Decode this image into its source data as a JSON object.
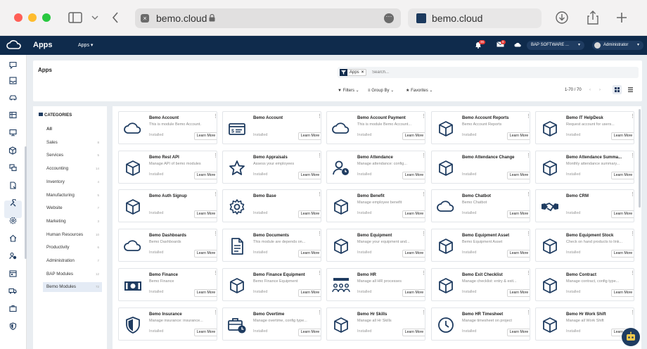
{
  "browser": {
    "url": "bemo.cloud",
    "tab_title": "bemo.cloud",
    "traffic_colors": [
      "#ff5f57",
      "#febc2e",
      "#28c840"
    ]
  },
  "navbar": {
    "title": "Apps",
    "apps_menu": "Apps ▾",
    "notifications_count": "36",
    "messages_count": "9",
    "company": "BAP SOFTWARE ...",
    "user": "Administrator",
    "bg_color": "#0f2b4c"
  },
  "sidebar": {
    "icons": [
      "chat-icon",
      "inbox-icon",
      "car-icon",
      "spreadsheet-icon",
      "desktop-icon",
      "box-icon",
      "chat-bubbles-icon",
      "document-icon",
      "tools-icon",
      "gear-icon",
      "home-icon",
      "user-clock-icon",
      "calendar-icon",
      "truck-icon",
      "briefcase-icon",
      "shield-icon"
    ]
  },
  "controls": {
    "breadcrumb": "Apps",
    "facet_label": "Apps",
    "search_placeholder": "Search...",
    "filters": "Filters",
    "group_by": "Group By",
    "favorites": "Favorites",
    "pager": "1-70 / 70"
  },
  "categories": {
    "heading": "CATEGORIES",
    "items": [
      {
        "label": "All",
        "count": ""
      },
      {
        "label": "Sales",
        "count": "8"
      },
      {
        "label": "Services",
        "count": "5"
      },
      {
        "label": "Accounting",
        "count": "14"
      },
      {
        "label": "Inventory",
        "count": "4"
      },
      {
        "label": "Manufacturing",
        "count": "5"
      },
      {
        "label": "Website",
        "count": "7"
      },
      {
        "label": "Marketing",
        "count": "3"
      },
      {
        "label": "Human Resources",
        "count": "10"
      },
      {
        "label": "Productivity",
        "count": "6"
      },
      {
        "label": "Administration",
        "count": "7"
      },
      {
        "label": "BAP Modules",
        "count": "12"
      },
      {
        "label": "Bemo Modules",
        "count": "72"
      }
    ]
  },
  "apps": [
    {
      "name": "Bemo Account",
      "desc": "This is module Bemo Account.",
      "status": "Installed",
      "button": "Learn More",
      "icon": "cloud-icon"
    },
    {
      "name": "Bemo Account",
      "desc": "",
      "status": "Installed",
      "button": "Learn More",
      "icon": "id-card-icon"
    },
    {
      "name": "Bemo Account Payment",
      "desc": "This is module Bemo Account...",
      "status": "Installed",
      "button": "Learn More",
      "icon": "cloud-icon"
    },
    {
      "name": "Bemo Account Reports",
      "desc": "Bemo Account Reports",
      "status": "Installed",
      "button": "Learn More",
      "icon": "box-icon"
    },
    {
      "name": "Bemo IT HelpDesk",
      "desc": "Request account for users...",
      "status": "Installed",
      "button": "Learn More",
      "icon": "box-icon"
    },
    {
      "name": "Bemo Rest API",
      "desc": "Manage API of bemo modules",
      "status": "Installed",
      "button": "Learn More",
      "icon": "box-icon"
    },
    {
      "name": "Bemo Appraisals",
      "desc": "Assess your employees",
      "status": "Installed",
      "button": "Learn More",
      "icon": "star-icon"
    },
    {
      "name": "Bemo Attendance",
      "desc": "Manage attendance: config...",
      "status": "Installed",
      "button": "Learn More",
      "icon": "user-clock-icon"
    },
    {
      "name": "Bemo Attendance Change",
      "desc": "",
      "status": "Installed",
      "button": "Learn More",
      "icon": "box-icon"
    },
    {
      "name": "Bemo Attendance Summa...",
      "desc": "Monthly attendance summary...",
      "status": "Installed",
      "button": "Learn More",
      "icon": "box-icon"
    },
    {
      "name": "Bemo Auth Signup",
      "desc": "",
      "status": "Installed",
      "button": "Learn More",
      "icon": "box-icon"
    },
    {
      "name": "Bemo Base",
      "desc": "",
      "status": "Installed",
      "button": "Learn More",
      "icon": "gear-icon"
    },
    {
      "name": "Bemo Benefit",
      "desc": "Manage employee benefit",
      "status": "Installed",
      "button": "Learn More",
      "icon": "box-icon"
    },
    {
      "name": "Bemo Chatbot",
      "desc": "Bemo Chatbot",
      "status": "Installed",
      "button": "Learn More",
      "icon": "cloud-icon"
    },
    {
      "name": "Bemo CRM",
      "desc": "",
      "status": "Installed",
      "button": "Learn More",
      "icon": "handshake-icon"
    },
    {
      "name": "Bemo Dashboards",
      "desc": "Bemo Dashboards",
      "status": "Installed",
      "button": "Learn More",
      "icon": "cloud-icon"
    },
    {
      "name": "Bemo Documents",
      "desc": "This module are depends on...",
      "status": "Installed",
      "button": "Learn More",
      "icon": "document-icon"
    },
    {
      "name": "Bemo Equipment",
      "desc": "Manage your equipment and...",
      "status": "Installed",
      "button": "Learn More",
      "icon": "box-icon"
    },
    {
      "name": "Bemo Equipment Asset",
      "desc": "Bemo Equipment Asset",
      "status": "Installed",
      "button": "Learn More",
      "icon": "box-icon"
    },
    {
      "name": "Bemo Equipment Stock",
      "desc": "Check on hand products to link...",
      "status": "Installed",
      "button": "Learn More",
      "icon": "box-icon"
    },
    {
      "name": "Bemo Finance",
      "desc": "Bemo Finance",
      "status": "Installed",
      "button": "Learn More",
      "icon": "money-icon"
    },
    {
      "name": "Bemo Finance Equipment",
      "desc": "Bemo Finance Equipment",
      "status": "Installed",
      "button": "Learn More",
      "icon": "box-icon"
    },
    {
      "name": "Bemo HR",
      "desc": "Manage all HR processes",
      "status": "Installed",
      "button": "Learn More",
      "icon": "people-icon"
    },
    {
      "name": "Bemo Exit Checklist",
      "desc": "Manage checklist: entry & exit...",
      "status": "Installed",
      "button": "Learn More",
      "icon": "box-icon"
    },
    {
      "name": "Bemo Contract",
      "desc": "Manage contract, config type...",
      "status": "Installed",
      "button": "Learn More",
      "icon": "box-icon"
    },
    {
      "name": "Bemo Insurance",
      "desc": "Manage insurance: insurance...",
      "status": "Installed",
      "button": "Learn More",
      "icon": "shield-icon"
    },
    {
      "name": "Bemo Overtime",
      "desc": "Manage overtime, config type...",
      "status": "Installed",
      "button": "Learn More",
      "icon": "briefcase-clock-icon"
    },
    {
      "name": "Bemo Hr Skills",
      "desc": "Manage all Hr Skills",
      "status": "Installed",
      "button": "Learn More",
      "icon": "box-icon"
    },
    {
      "name": "Bemo HR Timesheet",
      "desc": "Manage timesheet on project",
      "status": "Installed",
      "button": "Learn More",
      "icon": "clock-icon"
    },
    {
      "name": "Bemo Hr Work Shift",
      "desc": "Manage all Work Shift",
      "status": "Installed",
      "button": "Learn More",
      "icon": "box-icon"
    }
  ]
}
